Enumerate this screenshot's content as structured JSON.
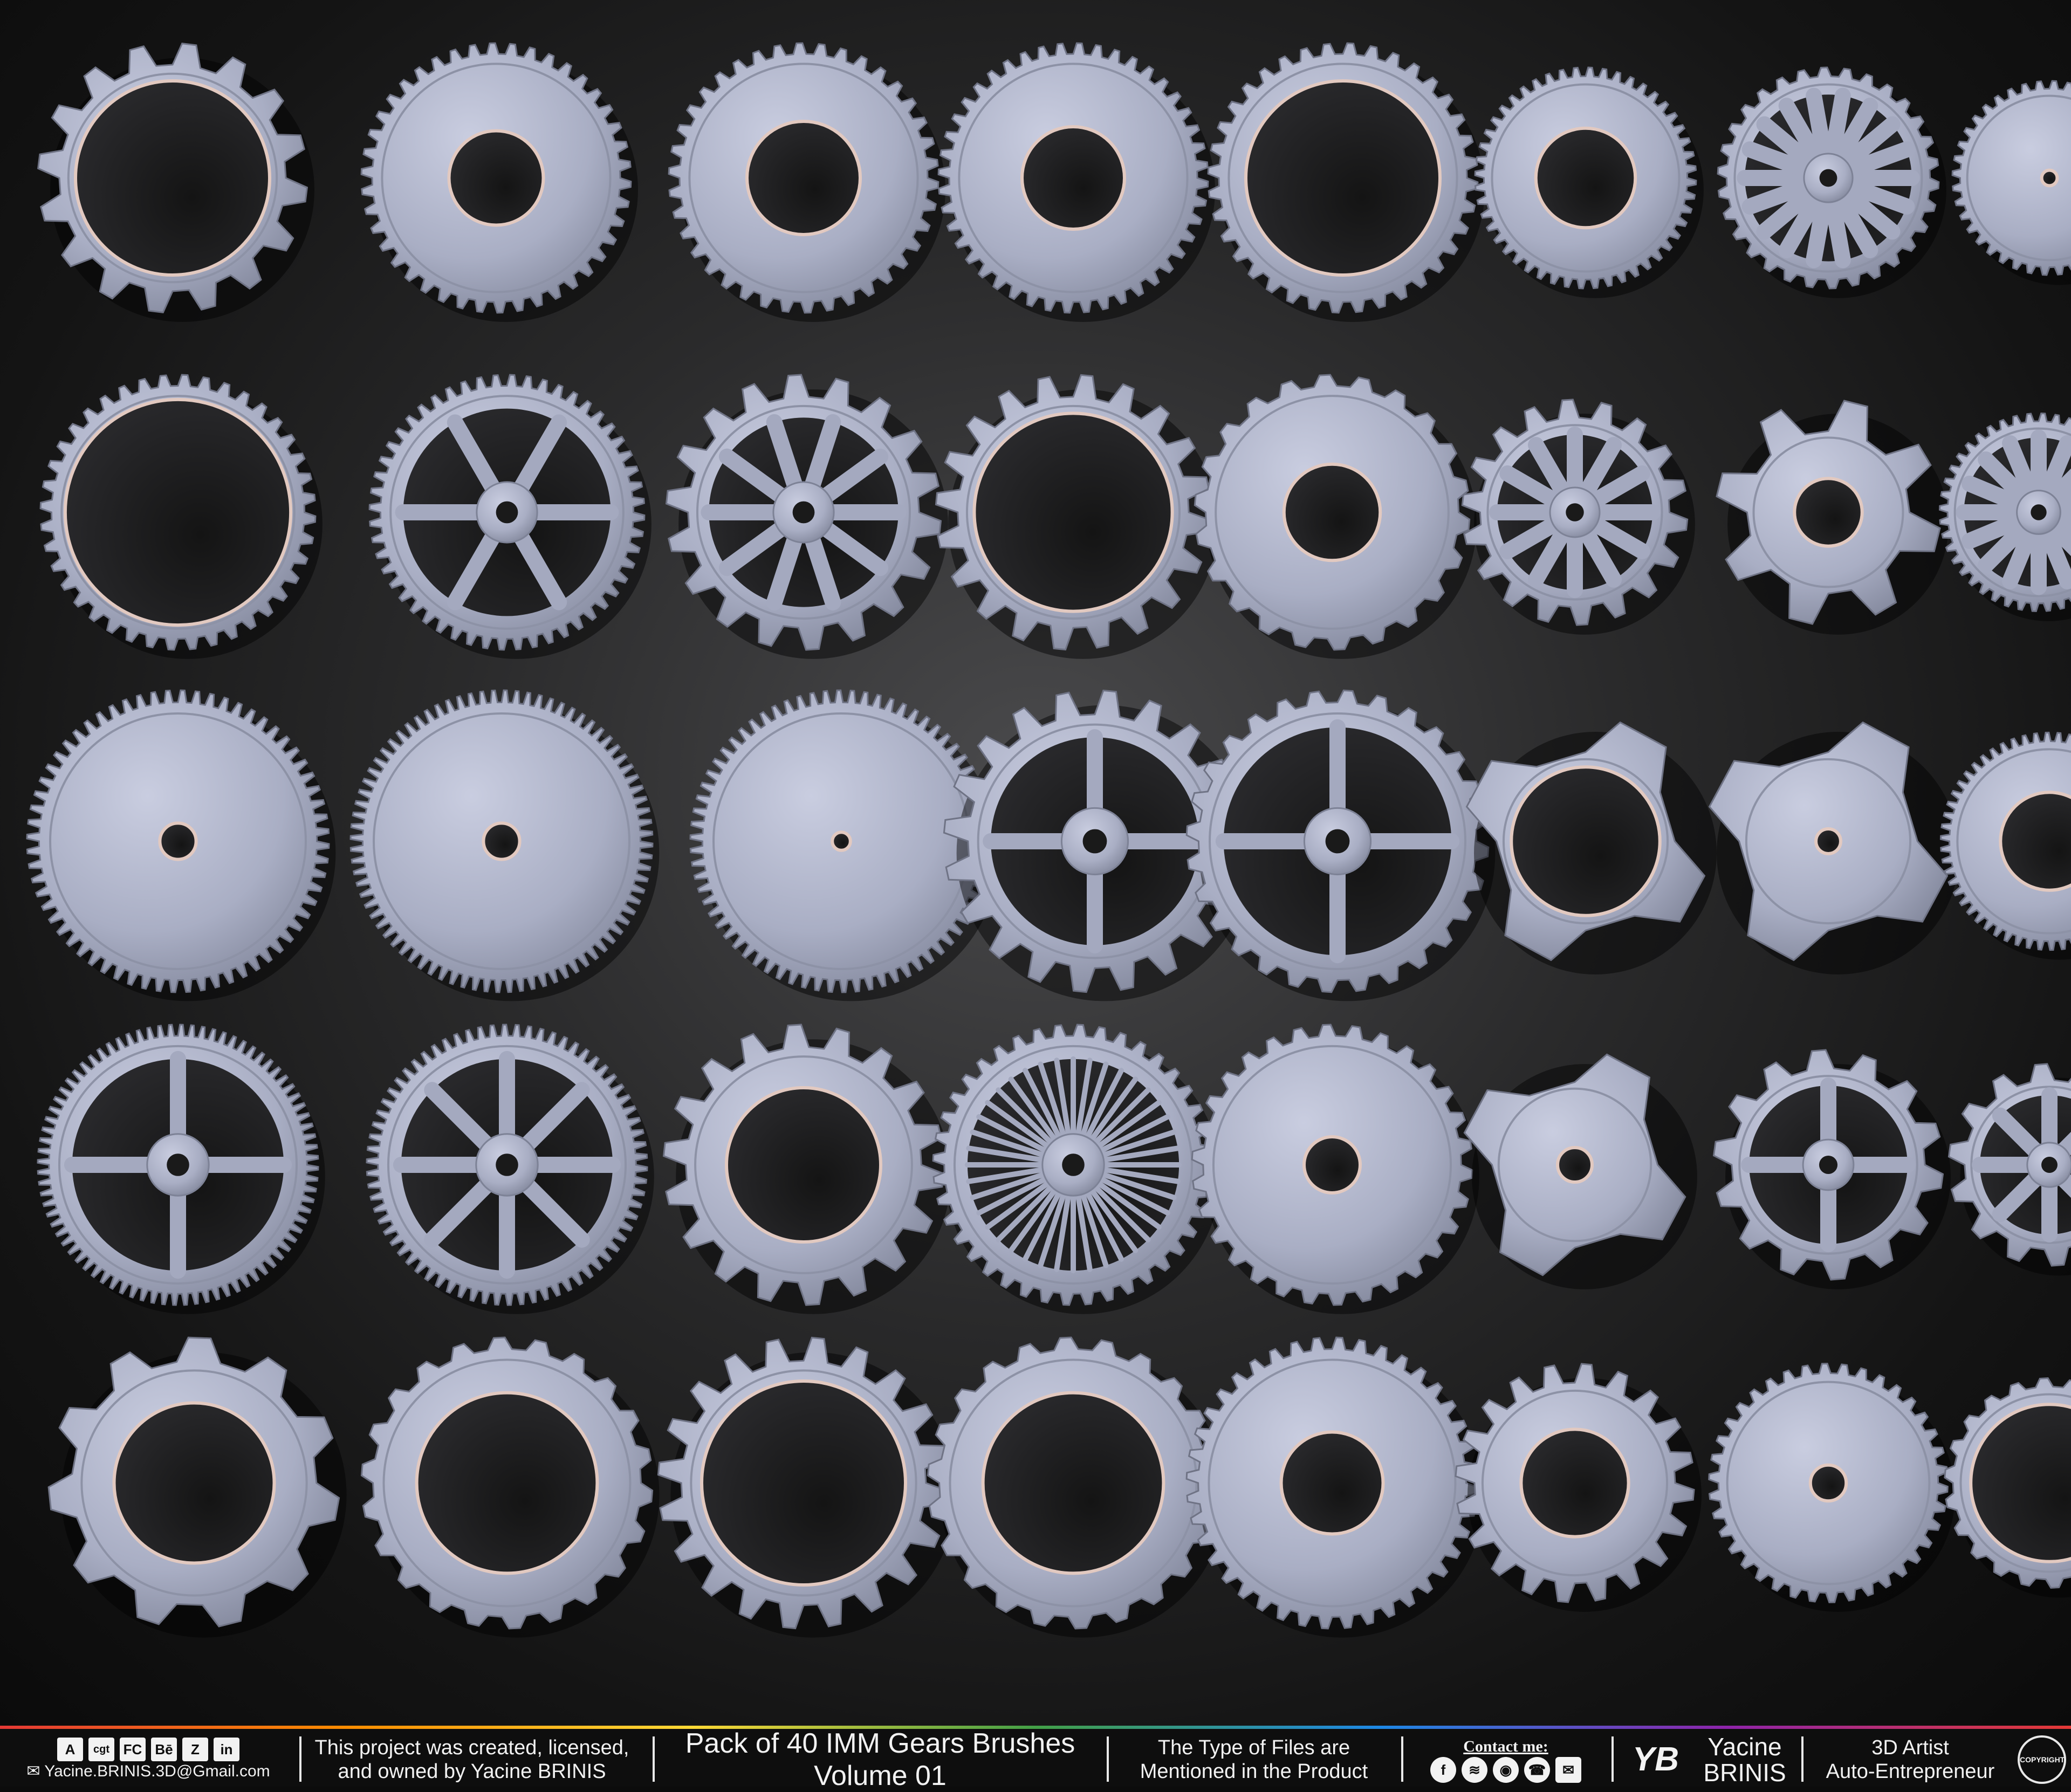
{
  "gear_color": "#a9aec4",
  "footer": {
    "email": "Yacine.BRINIS.3D@Gmail.com",
    "logo_labels": [
      "A",
      "cgt",
      "FC",
      "Bē",
      "Z",
      "in"
    ],
    "ownership_line1": "This project was created, licensed,",
    "ownership_line2": "and owned by Yacine BRINIS",
    "product_title": "Pack of 40 IMM Gears Brushes Volume 01",
    "files_line1": "The Type of Files are",
    "files_line2": "Mentioned in the Product",
    "contact_label": "Contact me:",
    "social_icons": [
      "facebook-icon",
      "messenger-icon",
      "instagram-icon",
      "whatsapp-icon",
      "email-icon"
    ],
    "author_first": "Yacine",
    "author_last": "BRINIS",
    "role_line1": "3D Artist",
    "role_line2": "Auto-Entrepreneur",
    "seal_text": "COPYRIGHT"
  }
}
